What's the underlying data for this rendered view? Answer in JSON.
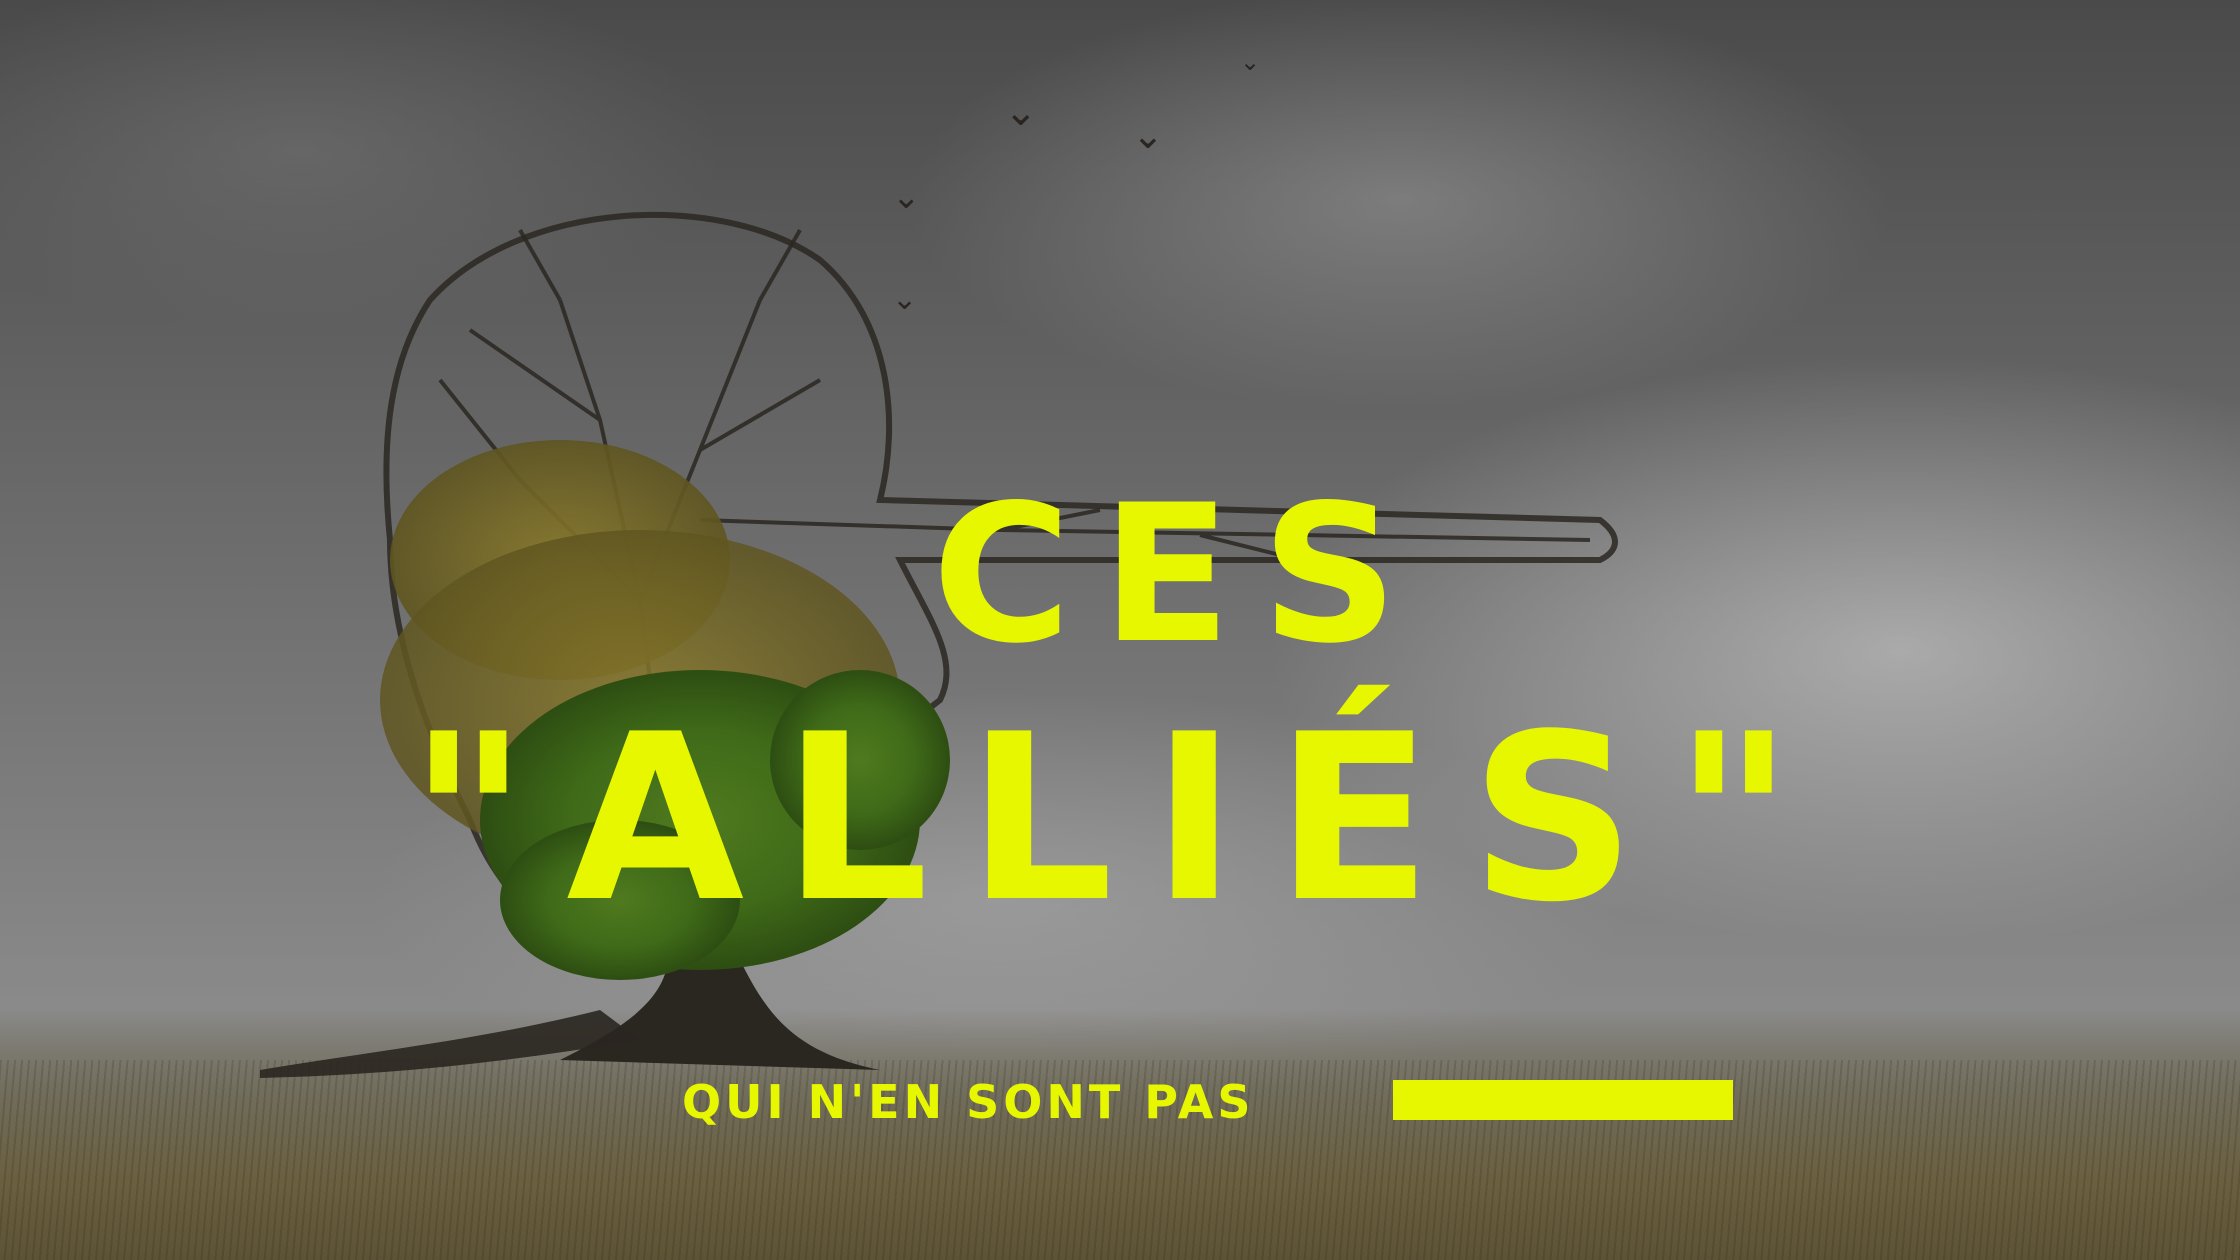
{
  "headline": {
    "line1": "CES",
    "line2": "\"ALLIÉS\""
  },
  "subtitle": "QUI N'EN SONT PAS",
  "colors": {
    "accent": "#e6f700",
    "sky": "#6b6b6b",
    "field": "#6a5f3f"
  },
  "icons": {
    "bird": "bird-icon"
  }
}
